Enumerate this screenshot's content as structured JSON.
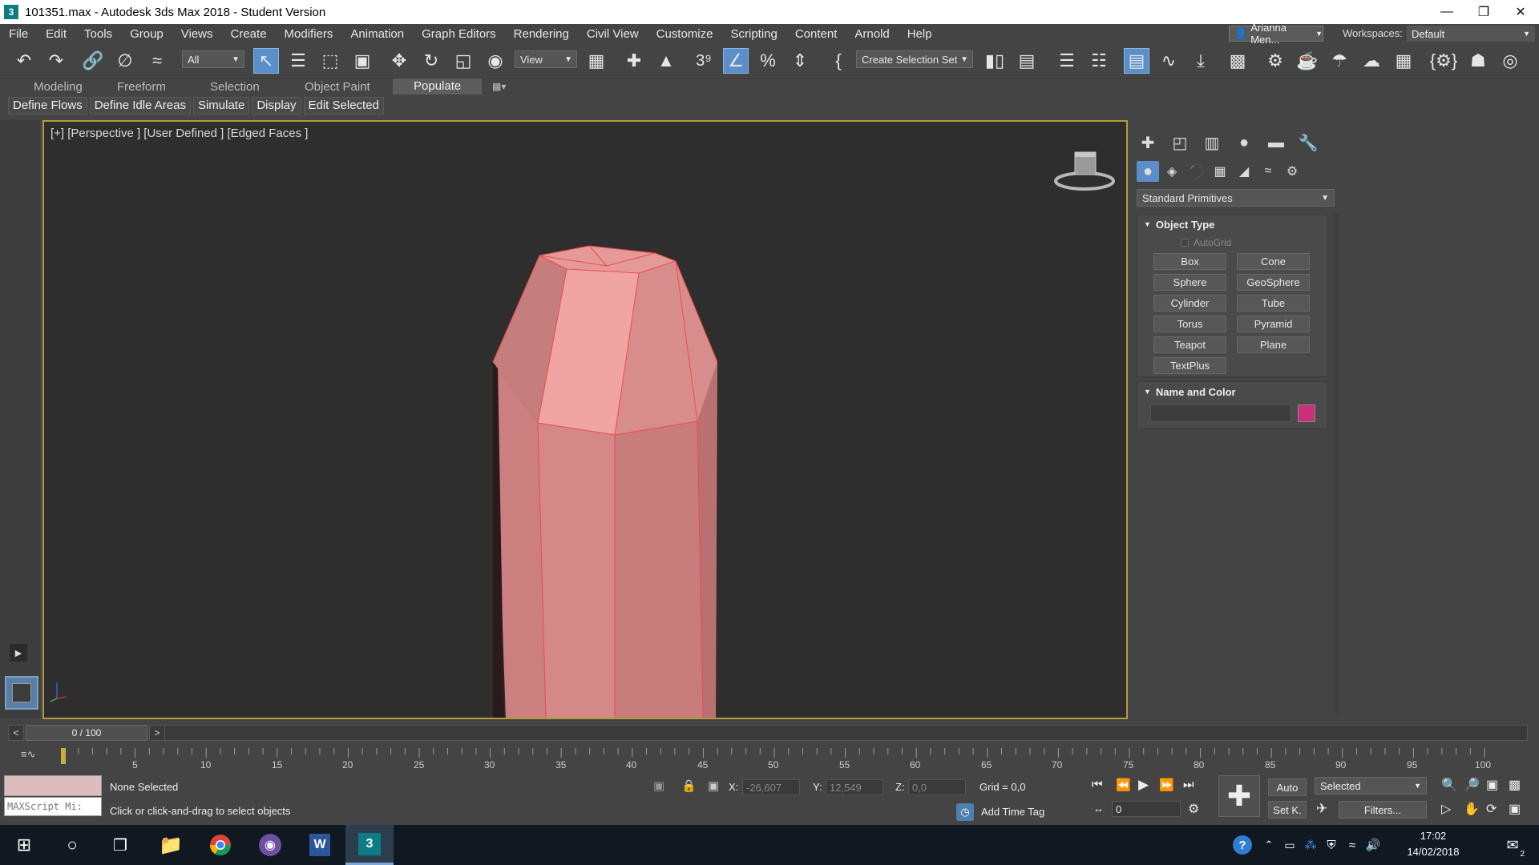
{
  "window": {
    "title": "101351.max - Autodesk 3ds Max 2018 - Student Version"
  },
  "menu": [
    "File",
    "Edit",
    "Tools",
    "Group",
    "Views",
    "Create",
    "Modifiers",
    "Animation",
    "Graph Editors",
    "Rendering",
    "Civil View",
    "Customize",
    "Scripting",
    "Content",
    "Arnold",
    "Help"
  ],
  "user": "Arianna Men...",
  "workspaces": {
    "label": "Workspaces:",
    "value": "Default"
  },
  "toolbar": {
    "filter": "All",
    "ref_coord": "View",
    "selection_set": "Create Selection Set"
  },
  "ribbon_tabs": [
    "Modeling",
    "Freeform",
    "Selection",
    "Object Paint",
    "Populate"
  ],
  "ribbon_active": "Populate",
  "populate_buttons": [
    "Define Flows",
    "Define Idle Areas",
    "Simulate",
    "Display",
    "Edit Selected"
  ],
  "viewport": {
    "label": "[+] [Perspective ] [User Defined ] [Edged Faces ]"
  },
  "command_panel": {
    "category": "Standard Primitives",
    "object_type_title": "Object Type",
    "autogrid": "AutoGrid",
    "primitives": [
      "Box",
      "Cone",
      "Sphere",
      "GeoSphere",
      "Cylinder",
      "Tube",
      "Torus",
      "Pyramid",
      "Teapot",
      "Plane",
      "TextPlus"
    ],
    "name_color_title": "Name and Color",
    "object_color": "#c8307a"
  },
  "timeline": {
    "frame": "0 / 100",
    "ticks": [
      "5",
      "10",
      "15",
      "20",
      "25",
      "30",
      "35",
      "40",
      "45",
      "50",
      "55",
      "60",
      "65",
      "70",
      "75",
      "80",
      "85",
      "90",
      "95",
      "100"
    ]
  },
  "status": {
    "maxscript": "MAXScript Mi:",
    "selection": "None Selected",
    "prompt": "Click or click-and-drag to select objects",
    "x_label": "X:",
    "x": "-26,607",
    "y_label": "Y:",
    "y": "12,549",
    "z_label": "Z:",
    "z": "0,0",
    "grid": "Grid = 0,0",
    "add_time_tag": "Add Time Tag",
    "auto": "Auto",
    "set_key": "Set K.",
    "key_filter": "Selected",
    "filters": "Filters...",
    "frame_field": "0"
  },
  "taskbar": {
    "time": "17:02",
    "date": "14/02/2018",
    "notifications": "2"
  }
}
